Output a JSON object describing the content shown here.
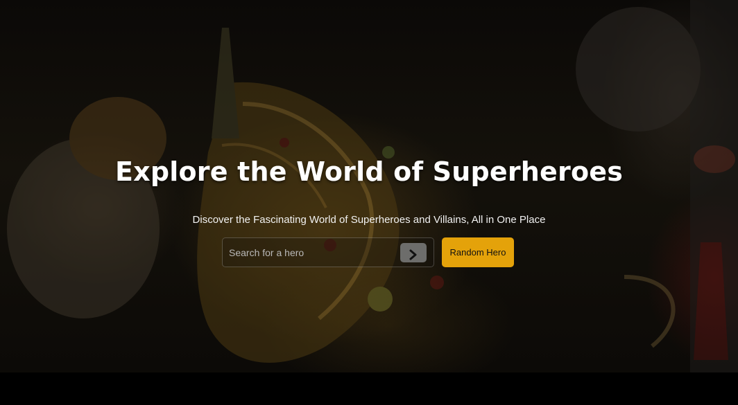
{
  "hero": {
    "title": "Explore the World of Superheroes",
    "subtitle": "Discover the Fascinating World of Superheroes and Villains, All in One Place",
    "background_image": "dark ornate carnival mask with jewels and gold embroidery"
  },
  "search": {
    "placeholder": "Search for a hero",
    "value": "",
    "submit_icon": "chevron-right-icon"
  },
  "actions": {
    "random_label": "Random Hero"
  },
  "colors": {
    "accent": "#e4a20a",
    "title_text": "#ffffff",
    "background": "#000000",
    "search_button": "#6d6d6b"
  }
}
